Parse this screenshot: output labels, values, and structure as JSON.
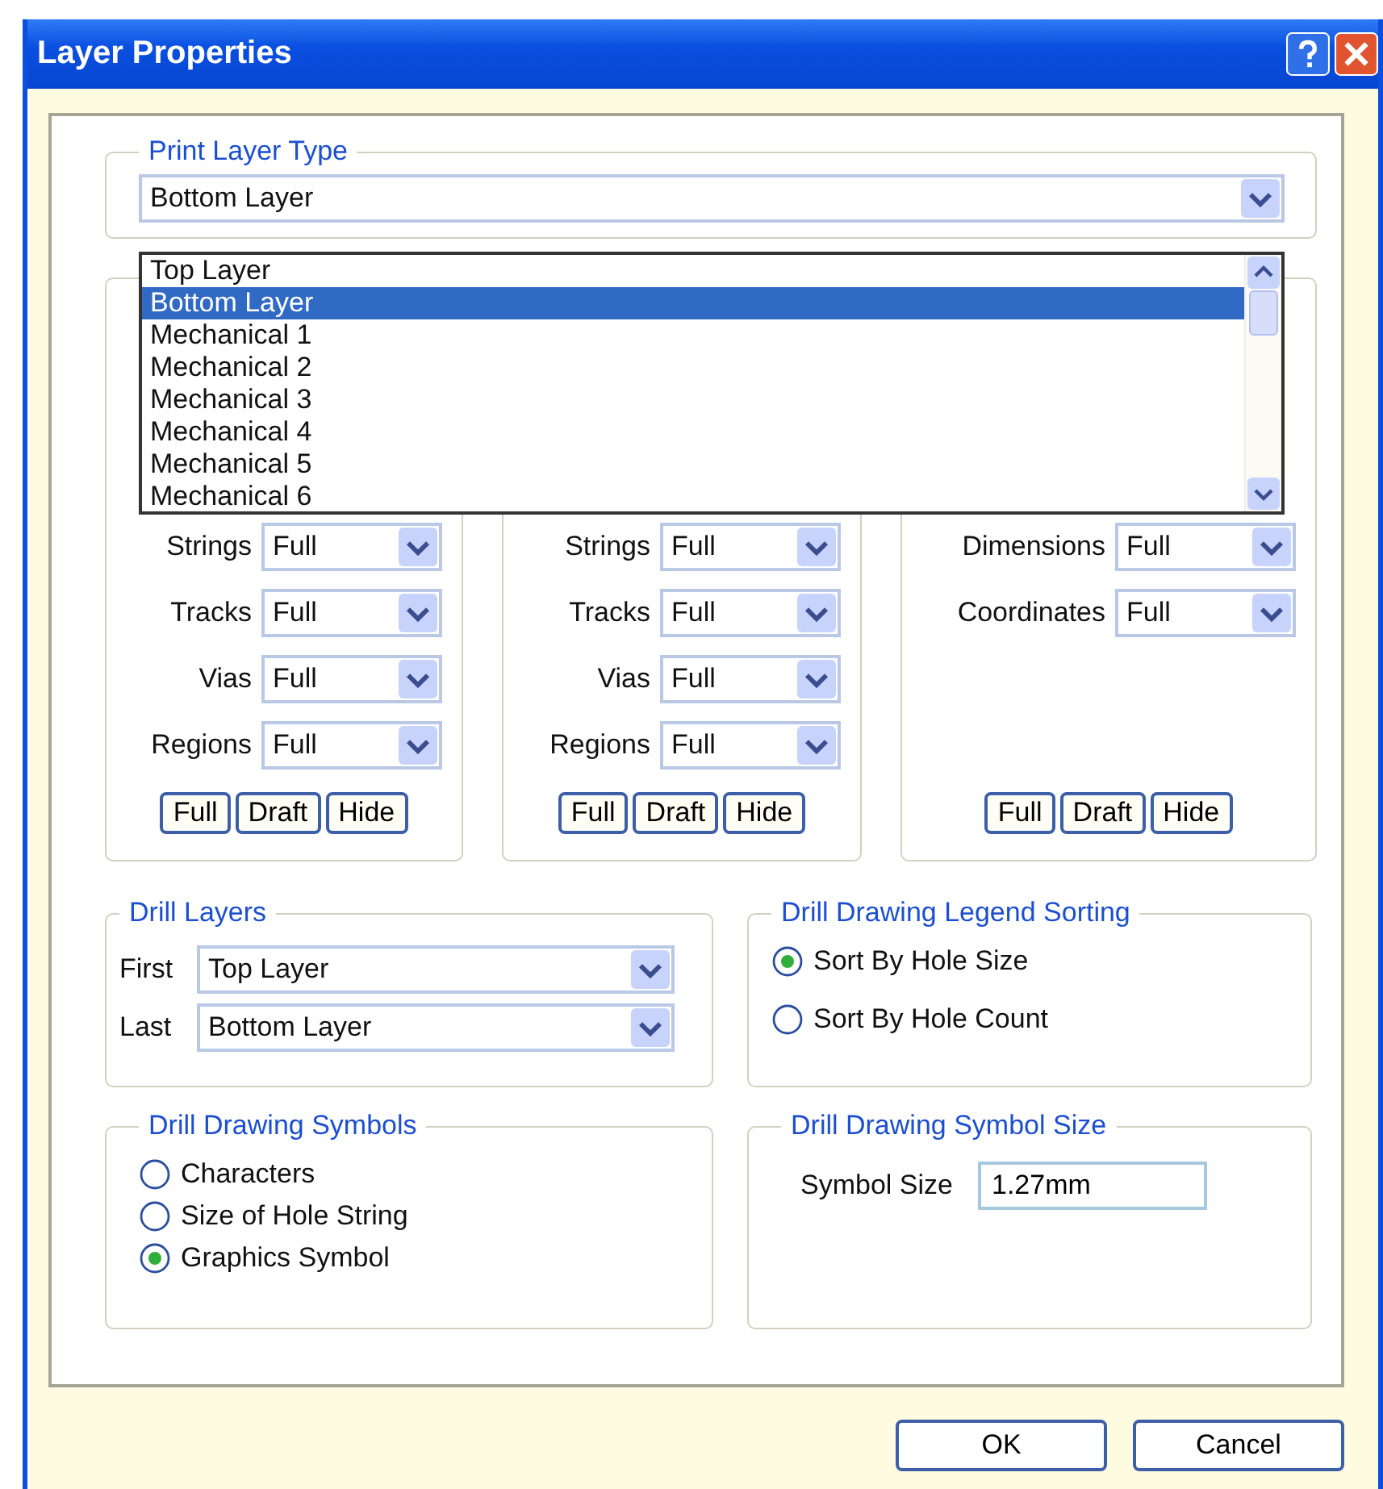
{
  "window": {
    "title": "Layer Properties"
  },
  "print_layer_type": {
    "title": "Print Layer Type",
    "value": "Bottom Layer",
    "options": [
      {
        "label": "Top Layer",
        "selected": false
      },
      {
        "label": "Bottom Layer",
        "selected": true
      },
      {
        "label": "Mechanical 1",
        "selected": false
      },
      {
        "label": "Mechanical 2",
        "selected": false
      },
      {
        "label": "Mechanical 3",
        "selected": false
      },
      {
        "label": "Mechanical 4",
        "selected": false
      },
      {
        "label": "Mechanical 5",
        "selected": false
      },
      {
        "label": "Mechanical 6",
        "selected": false
      }
    ]
  },
  "layer_groups": [
    {
      "rows": [
        {
          "label": "Strings",
          "value": "Full"
        },
        {
          "label": "Tracks",
          "value": "Full"
        },
        {
          "label": "Vias",
          "value": "Full"
        },
        {
          "label": "Regions",
          "value": "Full"
        }
      ],
      "buttons": [
        "Full",
        "Draft",
        "Hide"
      ]
    },
    {
      "rows": [
        {
          "label": "Strings",
          "value": "Full"
        },
        {
          "label": "Tracks",
          "value": "Full"
        },
        {
          "label": "Vias",
          "value": "Full"
        },
        {
          "label": "Regions",
          "value": "Full"
        }
      ],
      "buttons": [
        "Full",
        "Draft",
        "Hide"
      ]
    },
    {
      "rows": [
        {
          "label": "Dimensions",
          "value": "Full"
        },
        {
          "label": "Coordinates",
          "value": "Full"
        }
      ],
      "buttons": [
        "Full",
        "Draft",
        "Hide"
      ]
    }
  ],
  "drill_layers": {
    "title": "Drill Layers",
    "fields": [
      {
        "label": "First",
        "value": "Top Layer"
      },
      {
        "label": "Last",
        "value": "Bottom Layer"
      }
    ]
  },
  "legend_sorting": {
    "title": "Drill Drawing Legend Sorting",
    "options": [
      {
        "label": "Sort By Hole Size",
        "selected": true
      },
      {
        "label": "Sort By Hole Count",
        "selected": false
      }
    ]
  },
  "drawing_symbols": {
    "title": "Drill Drawing Symbols",
    "options": [
      {
        "label": "Characters",
        "selected": false
      },
      {
        "label": "Size of Hole String",
        "selected": false
      },
      {
        "label": "Graphics Symbol",
        "selected": true
      }
    ]
  },
  "symbol_size": {
    "title": "Drill Drawing Symbol Size",
    "label": "Symbol Size",
    "value": "1.27mm"
  },
  "buttons": [
    "OK",
    "Cancel"
  ]
}
